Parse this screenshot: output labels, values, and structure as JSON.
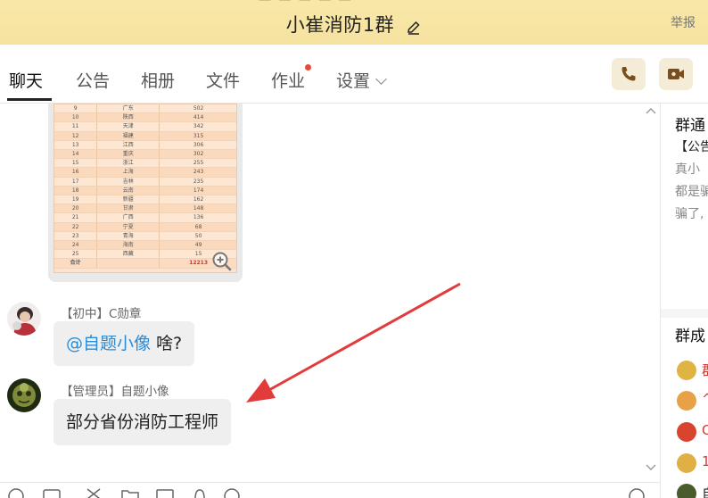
{
  "window": {
    "title": "小崔消防1群",
    "report_label": "举报",
    "scrap_text": "一 一 一 一 一"
  },
  "tabs": [
    {
      "label": "聊天",
      "active": true
    },
    {
      "label": "公告"
    },
    {
      "label": "相册"
    },
    {
      "label": "文件"
    },
    {
      "label": "作业",
      "badge": true
    },
    {
      "label": "设置",
      "dropdown": true
    }
  ],
  "image_table": {
    "rows": [
      [
        "9",
        "广东",
        "502"
      ],
      [
        "10",
        "陕西",
        "414"
      ],
      [
        "11",
        "天津",
        "342"
      ],
      [
        "12",
        "福建",
        "315"
      ],
      [
        "13",
        "江西",
        "306"
      ],
      [
        "14",
        "重庆",
        "302"
      ],
      [
        "15",
        "浙江",
        "255"
      ],
      [
        "16",
        "上海",
        "243"
      ],
      [
        "17",
        "吉林",
        "235"
      ],
      [
        "18",
        "云南",
        "174"
      ],
      [
        "19",
        "新疆",
        "162"
      ],
      [
        "20",
        "甘肃",
        "148"
      ],
      [
        "21",
        "广西",
        "136"
      ],
      [
        "22",
        "宁夏",
        "68"
      ],
      [
        "23",
        "青海",
        "50"
      ],
      [
        "24",
        "海南",
        "49"
      ],
      [
        "25",
        "西藏",
        "15"
      ]
    ],
    "total": [
      "合计",
      "",
      "12213"
    ]
  },
  "messages": [
    {
      "sender": "【初中】C勋章",
      "mention": "@自题小像",
      "text": " 啥?"
    },
    {
      "sender": "【管理员】自题小像",
      "text": "部分省份消防工程师"
    }
  ],
  "right_panel": {
    "notice_title": "群通",
    "notice_tag": "【公告",
    "notice_lines": [
      "真小",
      "都是骗",
      "骗了,"
    ],
    "members_title": "群成",
    "members": [
      {
        "name": "群",
        "color": "#e0b443"
      },
      {
        "name": "^",
        "color": "#e7a248"
      },
      {
        "name": "C",
        "color": "#d9442f"
      },
      {
        "name": "1",
        "color": "#e1b044"
      },
      {
        "name": "自",
        "color": "#4a5a2a"
      }
    ]
  },
  "colors": {
    "titlebar_bg": "#f7e5a4",
    "accent_red": "#d03a2a",
    "mention_blue": "#2a8bd6",
    "bubble_bg": "#efefef"
  }
}
